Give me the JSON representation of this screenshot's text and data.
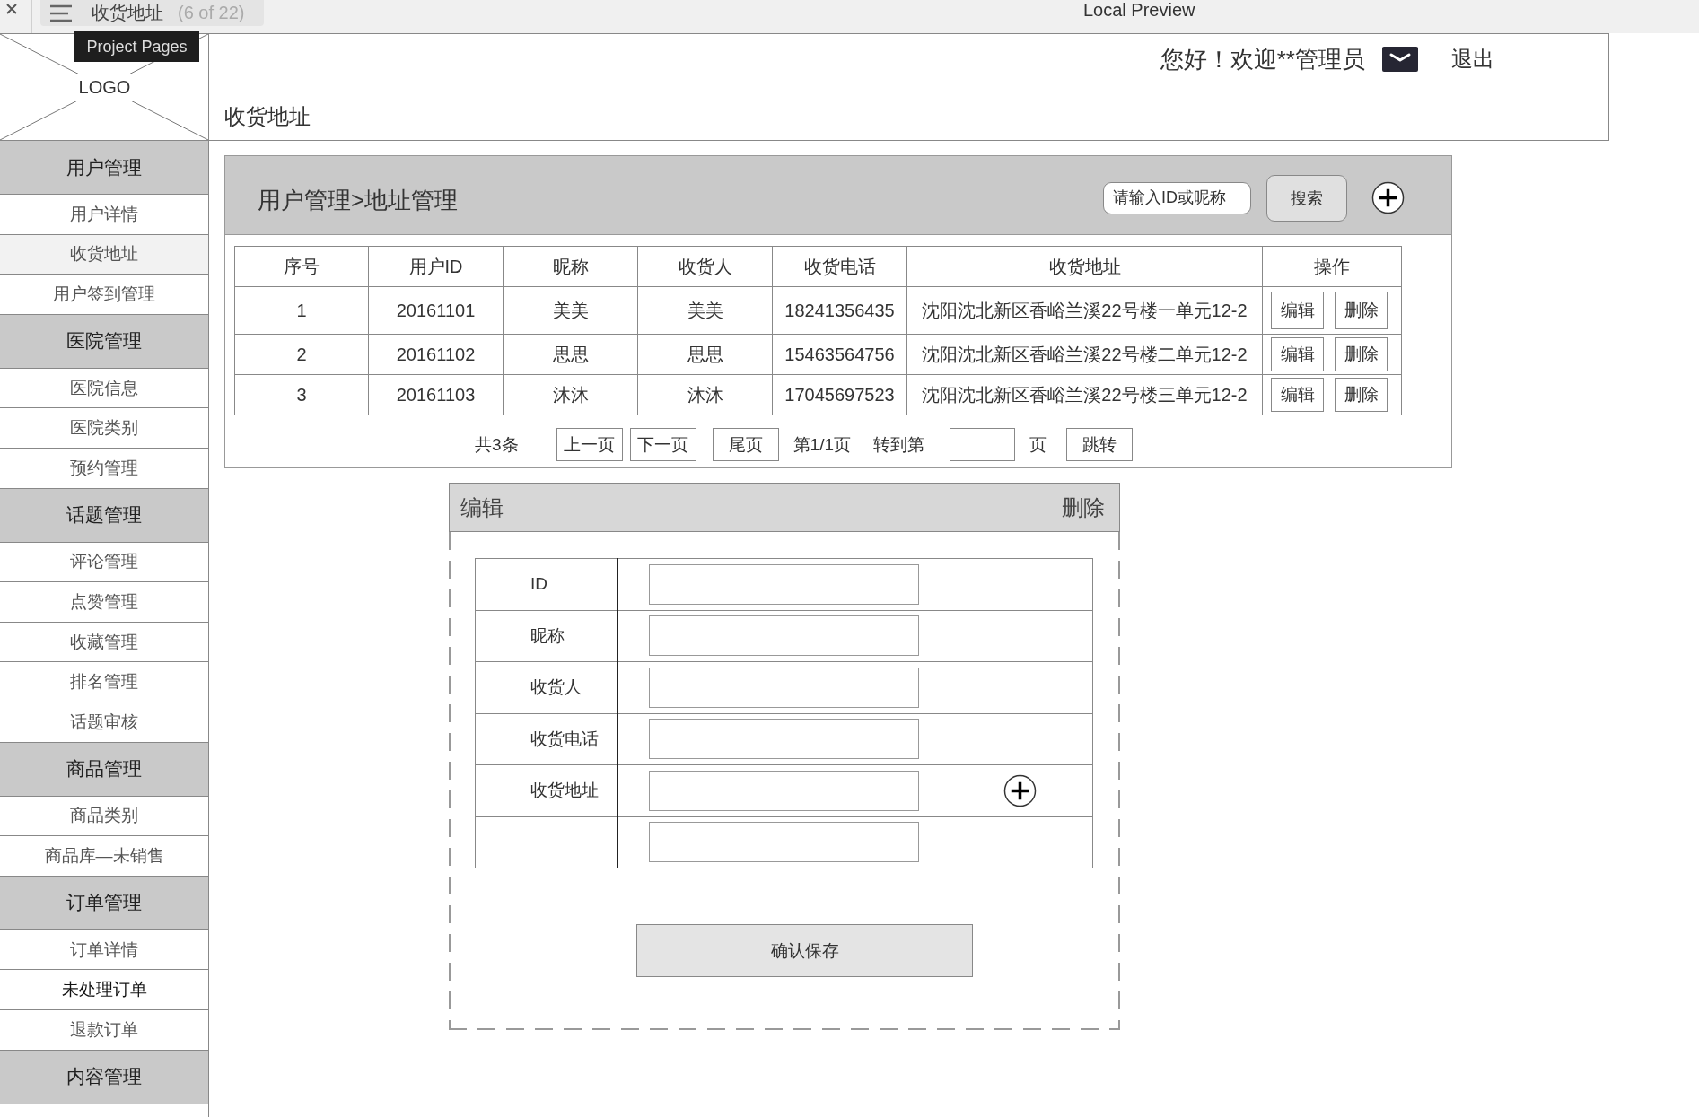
{
  "topbar": {
    "page_tab": {
      "title": "收货地址",
      "counter": "(6 of 22)"
    },
    "preview_title": "Local Preview",
    "tooltip": "Project Pages"
  },
  "logo": {
    "text": "LOGO"
  },
  "header": {
    "greeting": "您好！欢迎**管理员",
    "logout": "退出",
    "page_title": "收货地址"
  },
  "sidebar": {
    "groups": [
      {
        "title": "用户管理",
        "items": [
          {
            "label": "用户详情",
            "selected": false,
            "emphasized": false
          },
          {
            "label": "收货地址",
            "selected": true,
            "emphasized": false
          },
          {
            "label": "用户签到管理",
            "selected": false,
            "emphasized": false
          }
        ]
      },
      {
        "title": "医院管理",
        "items": [
          {
            "label": "医院信息",
            "selected": false,
            "emphasized": false
          },
          {
            "label": "医院类别",
            "selected": false,
            "emphasized": false
          },
          {
            "label": "预约管理",
            "selected": false,
            "emphasized": false
          }
        ]
      },
      {
        "title": "话题管理",
        "items": [
          {
            "label": "评论管理",
            "selected": false,
            "emphasized": false
          },
          {
            "label": "点赞管理",
            "selected": false,
            "emphasized": false
          },
          {
            "label": "收藏管理",
            "selected": false,
            "emphasized": false
          },
          {
            "label": "排名管理",
            "selected": false,
            "emphasized": false
          },
          {
            "label": "话题审核",
            "selected": false,
            "emphasized": false
          }
        ]
      },
      {
        "title": "商品管理",
        "items": [
          {
            "label": "商品类别",
            "selected": false,
            "emphasized": false
          },
          {
            "label": "商品库—未销售",
            "selected": false,
            "emphasized": false
          }
        ]
      },
      {
        "title": "订单管理",
        "items": [
          {
            "label": "订单详情",
            "selected": false,
            "emphasized": false
          },
          {
            "label": "未处理订单",
            "selected": false,
            "emphasized": true
          },
          {
            "label": "退款订单",
            "selected": false,
            "emphasized": false
          }
        ]
      },
      {
        "title": "内容管理"
      }
    ]
  },
  "address_panel": {
    "breadcrumb": "用户管理>地址管理",
    "search": {
      "placeholder": "请输入ID或昵称"
    },
    "search_button": "搜索",
    "table": {
      "columns": [
        "序号",
        "用户ID",
        "昵称",
        "收货人",
        "收货电话",
        "收货地址",
        "操作"
      ],
      "rows": [
        {
          "cells": [
            "1",
            "20161101",
            "美美",
            "美美",
            "18241356435",
            "沈阳沈北新区香峪兰溪22号楼一单元12-2"
          ],
          "actions": [
            "编辑",
            "删除"
          ]
        },
        {
          "cells": [
            "2",
            "20161102",
            "思思",
            "思思",
            "15463564756",
            "沈阳沈北新区香峪兰溪22号楼二单元12-2"
          ],
          "actions": [
            "编辑",
            "删除"
          ]
        },
        {
          "cells": [
            "3",
            "20161103",
            "沐沐",
            "沐沐",
            "17045697523",
            "沈阳沈北新区香峪兰溪22号楼三单元12-2"
          ],
          "actions": [
            "编辑",
            "删除"
          ]
        }
      ]
    },
    "pagination": {
      "total": "共3条",
      "prev_button": "上一页",
      "next_button": "下一页",
      "last_button": "尾页",
      "page_info": "第1/1页",
      "goto_label": "转到第",
      "page_suffix": "页",
      "goto_button": "跳转"
    }
  },
  "edit_form": {
    "title": "编辑",
    "delete": "删除",
    "fields": [
      {
        "kind": "text",
        "label": "ID"
      },
      {
        "kind": "text",
        "label": "昵称"
      },
      {
        "kind": "text",
        "label": "收货人"
      },
      {
        "kind": "text",
        "label": "收货电话"
      },
      {
        "kind": "address",
        "label": "收货地址"
      },
      {
        "kind": "extra"
      }
    ],
    "save_button": "确认保存"
  }
}
